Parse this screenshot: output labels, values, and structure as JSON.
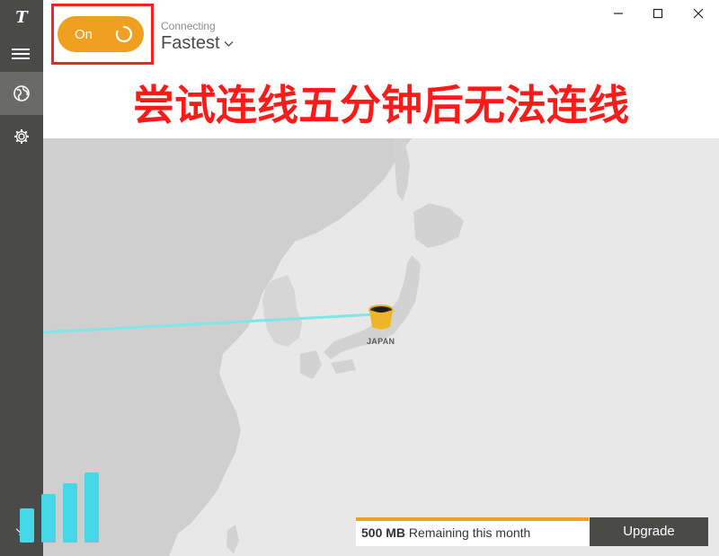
{
  "app": {
    "logo_glyph": "T"
  },
  "sidebar": {
    "items": [
      {
        "icon": "hamburger-menu-icon"
      },
      {
        "icon": "globe-icon",
        "active": true
      },
      {
        "icon": "gear-icon"
      }
    ],
    "expand_glyph": "↘"
  },
  "vpn": {
    "toggle_label": "On",
    "toggle_state": "connecting",
    "status": "Connecting",
    "server": "Fastest",
    "accent": "#f0a020"
  },
  "banner": {
    "text": "尝试连线五分钟后无法连线",
    "color": "#ff1a1a"
  },
  "map": {
    "country_label": "JAPAN",
    "route_color": "#7ee6e6",
    "land_color": "#cfcfcf",
    "sea_color": "#e8e8e8"
  },
  "data_usage": {
    "amount": "500 MB",
    "text": "Remaining this month",
    "progress": 0.995
  },
  "upgrade": {
    "label": "Upgrade"
  },
  "window": {
    "minimize": "minimize-icon",
    "maximize": "maximize-icon",
    "close": "close-icon"
  }
}
